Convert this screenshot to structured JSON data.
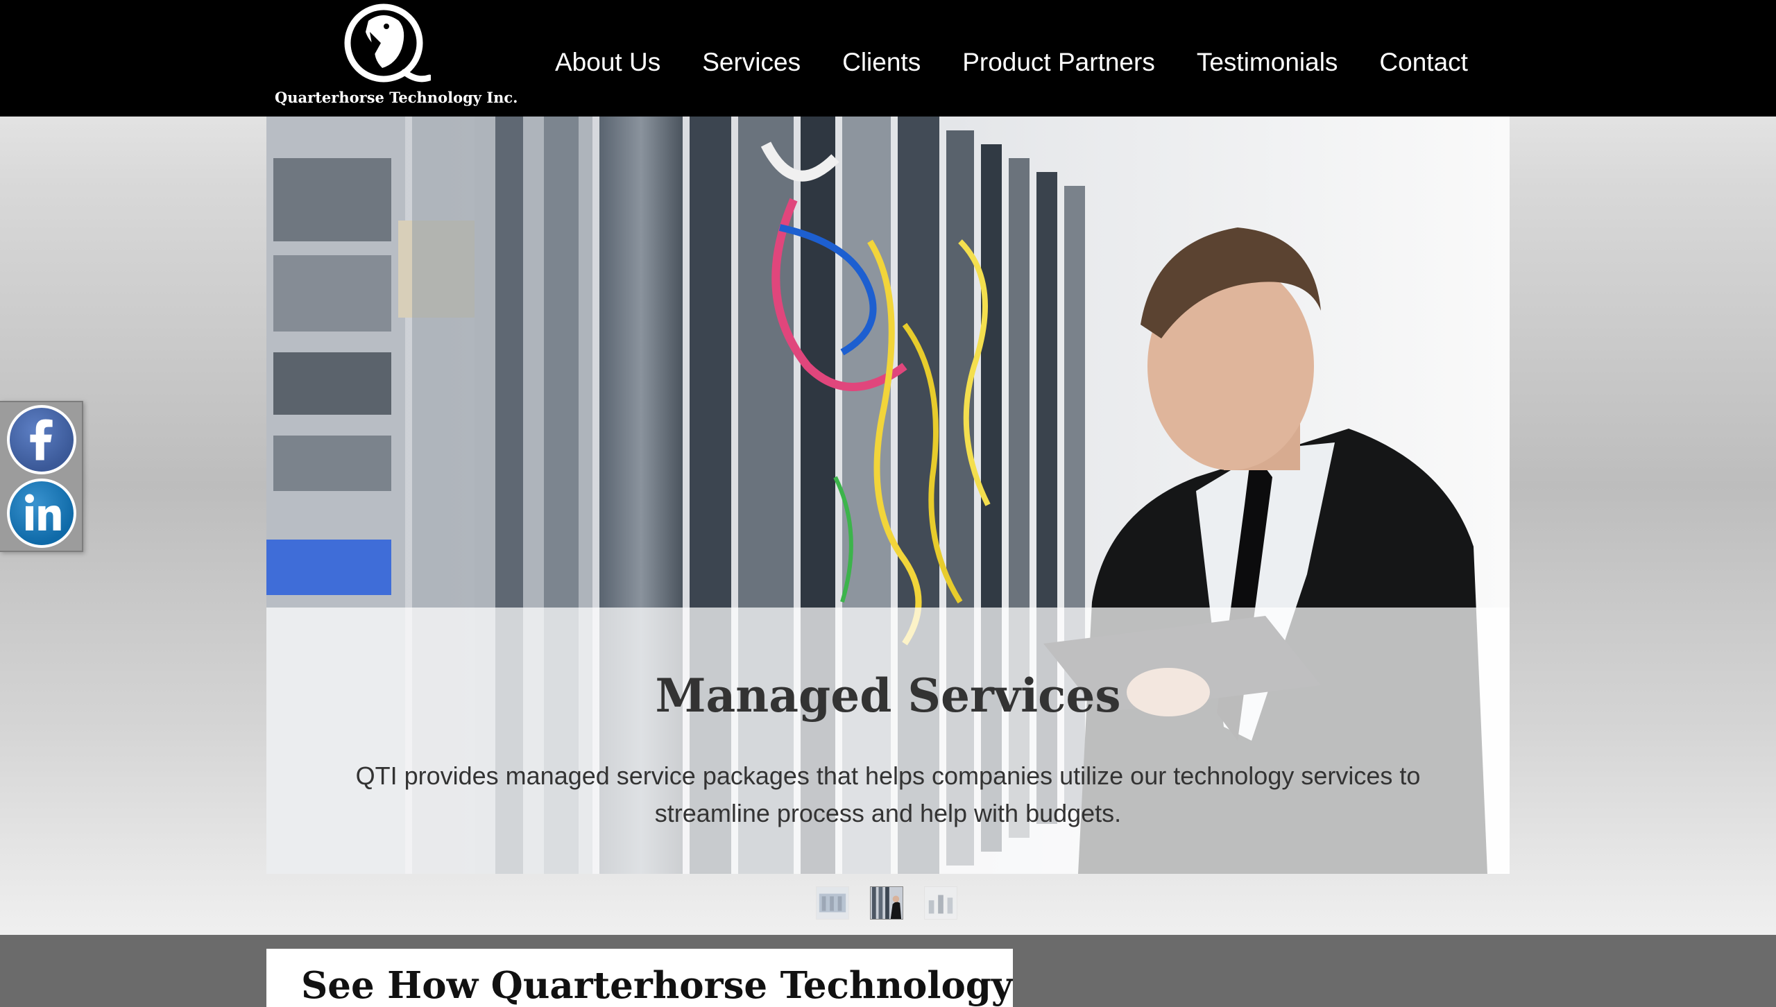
{
  "brand": {
    "name": "Quarterhorse Technology Inc.",
    "logo_icon": "horse-head-q-logo"
  },
  "nav": {
    "items": [
      {
        "label": "About Us"
      },
      {
        "label": "Services"
      },
      {
        "label": "Clients"
      },
      {
        "label": "Product Partners"
      },
      {
        "label": "Testimonials"
      },
      {
        "label": "Contact"
      }
    ]
  },
  "social": {
    "facebook_icon": "facebook-icon",
    "linkedin_icon": "linkedin-icon"
  },
  "hero": {
    "title": "Managed Services",
    "text": "QTI provides managed service packages that helps companies utilize our technology services to streamline process and help with budgets.",
    "slide_count": 3,
    "active_slide": 2
  },
  "promo": {
    "title": "See How Quarterhorse Technology Can"
  },
  "colors": {
    "header_bg": "#000000",
    "facebook_blue": "#3b5998",
    "linkedin_blue": "#0f6aa8",
    "bottom_bg": "#6b6b6b"
  }
}
